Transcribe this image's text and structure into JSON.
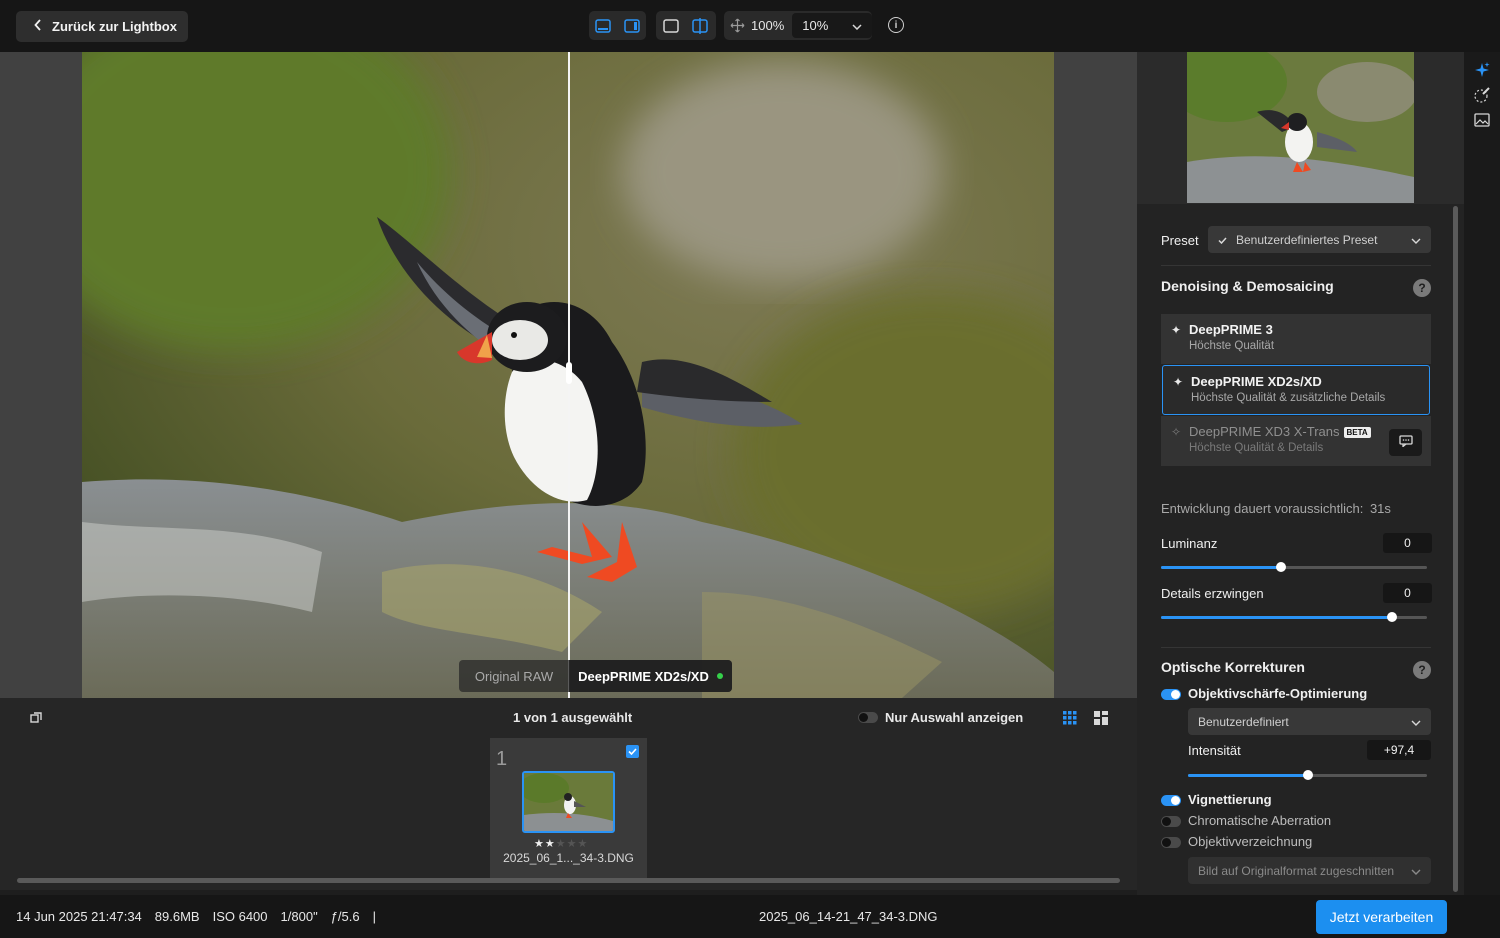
{
  "topbar": {
    "back_label": "Zurück zur Lightbox",
    "zoom_fit": "100%",
    "zoom_value": "10%"
  },
  "viewer": {
    "compare_left": "Original RAW",
    "compare_right": "DeepPRIME XD2s/XD"
  },
  "filmstrip": {
    "selection_text": "1 von 1 ausgewählt",
    "show_selection_label": "Nur Auswahl anzeigen",
    "thumb": {
      "index": "1",
      "filename": "2025_06_1..._34-3.DNG",
      "rating": 2,
      "rating_max": 5
    }
  },
  "statusbar": {
    "date": "14 Jun 2025 21:47:34",
    "size": "89.6MB",
    "iso": "ISO 6400",
    "shutter": "1/800\"",
    "aperture": "ƒ/5.6",
    "sep": "|",
    "filename": "2025_06_14-21_47_34-3.DNG",
    "process_label": "Jetzt verarbeiten"
  },
  "panel": {
    "preset_label": "Preset",
    "preset_value": "Benutzerdefiniertes Preset",
    "denoise_title": "Denoising & Demosaicing",
    "options": [
      {
        "title": "DeepPRIME 3",
        "sub": "Höchste Qualität"
      },
      {
        "title": "DeepPRIME XD2s/XD",
        "sub": "Höchste Qualität & zusätzliche Details"
      },
      {
        "title": "DeepPRIME XD3 X-Trans",
        "sub": "Höchste Qualität & Details",
        "badge": "BETA"
      }
    ],
    "dev_time_label": "Entwicklung dauert voraussichtlich:",
    "dev_time_value": "31s",
    "luminance_label": "Luminanz",
    "luminance_value": "0",
    "luminance_level": 0.45,
    "details_label": "Details erzwingen",
    "details_value": "0",
    "details_level": 0.87,
    "optical_title": "Optische Korrekturen",
    "sharpness_label": "Objektivschärfe-Optimierung",
    "sharpness_mode": "Benutzerdefiniert",
    "intensity_label": "Intensität",
    "intensity_value": "+97,4",
    "intensity_level": 0.5,
    "vignette_label": "Vignettierung",
    "chromatic_label": "Chromatische Aberration",
    "distortion_label": "Objektivverzeichnung",
    "crop_label": "Bild auf Originalformat zugeschnitten"
  },
  "colors": {
    "accent": "#2a93f5",
    "process_button": "#1c8ff0",
    "panel_bg": "#232323"
  }
}
